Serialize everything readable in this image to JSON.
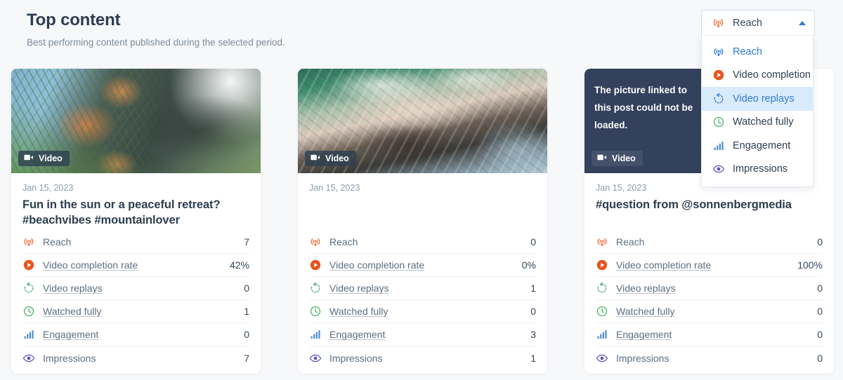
{
  "header": {
    "title": "Top content",
    "subtitle": "Best performing content published during the selected period."
  },
  "metric_selector": {
    "selected_label": "Reach",
    "selected_icon": "reach-antenna-icon",
    "chevron_icon": "chevron-up-icon",
    "options": [
      {
        "label": "Reach",
        "icon": "reach-antenna-icon",
        "state": "selected"
      },
      {
        "label": "Video completion rate",
        "icon": "play-circle-icon",
        "state": "normal"
      },
      {
        "label": "Video replays",
        "icon": "replay-arrow-icon",
        "state": "highlighted"
      },
      {
        "label": "Watched fully",
        "icon": "clock-icon",
        "state": "normal"
      },
      {
        "label": "Engagement",
        "icon": "bar-chart-icon",
        "state": "normal"
      },
      {
        "label": "Impressions",
        "icon": "eye-icon",
        "state": "normal"
      }
    ]
  },
  "colors": {
    "page_background": "#f7f8fa",
    "card_background": "#ffffff",
    "accent_blue": "#2e7cd6",
    "highlight_blue": "#d9ebfb",
    "reach_orange": "#f2703f",
    "video_orange": "#e8551f",
    "replay_green": "#4caf7d",
    "clock_green": "#3fae5a",
    "engagement_blue": "#4e8fd1",
    "impressions_purple": "#5b4bb5",
    "placeholder_navy": "#33415c",
    "title_navy": "#2d3e50"
  },
  "cards": [
    {
      "media": {
        "art": "palm-beach-photo",
        "badge_label": "Video",
        "badge_icon": "video-camera-icon",
        "placeholder_text": ""
      },
      "date": "Jan 15, 2023",
      "title": "Fun in the sun or a peaceful retreat? #beachvibes #mountainlover",
      "metrics": [
        {
          "label": "Reach",
          "icon": "reach-antenna-icon",
          "value": "7",
          "linked": false
        },
        {
          "label": "Video completion rate",
          "icon": "play-circle-icon",
          "value": "42%",
          "linked": true
        },
        {
          "label": "Video replays",
          "icon": "replay-arrow-icon",
          "value": "0",
          "linked": true
        },
        {
          "label": "Watched fully",
          "icon": "clock-icon",
          "value": "1",
          "linked": true
        },
        {
          "label": "Engagement",
          "icon": "bar-chart-icon",
          "value": "0",
          "linked": true
        },
        {
          "label": "Impressions",
          "icon": "eye-icon",
          "value": "7",
          "linked": false
        }
      ]
    },
    {
      "media": {
        "art": "ocean-aerial-photo",
        "badge_label": "Video",
        "badge_icon": "video-camera-icon",
        "placeholder_text": ""
      },
      "date": "Jan 15, 2023",
      "title": "",
      "metrics": [
        {
          "label": "Reach",
          "icon": "reach-antenna-icon",
          "value": "0",
          "linked": false
        },
        {
          "label": "Video completion rate",
          "icon": "play-circle-icon",
          "value": "0%",
          "linked": true
        },
        {
          "label": "Video replays",
          "icon": "replay-arrow-icon",
          "value": "1",
          "linked": true
        },
        {
          "label": "Watched fully",
          "icon": "clock-icon",
          "value": "0",
          "linked": true
        },
        {
          "label": "Engagement",
          "icon": "bar-chart-icon",
          "value": "3",
          "linked": true
        },
        {
          "label": "Impressions",
          "icon": "eye-icon",
          "value": "1",
          "linked": false
        }
      ]
    },
    {
      "media": {
        "art": "broken-image-placeholder",
        "badge_label": "Video",
        "badge_icon": "video-camera-icon",
        "placeholder_text": "The picture linked to this post could not be loaded."
      },
      "date": "Jan 15, 2023",
      "title": "#question from @sonnenbergmedia",
      "metrics": [
        {
          "label": "Reach",
          "icon": "reach-antenna-icon",
          "value": "0",
          "linked": false
        },
        {
          "label": "Video completion rate",
          "icon": "play-circle-icon",
          "value": "100%",
          "linked": true
        },
        {
          "label": "Video replays",
          "icon": "replay-arrow-icon",
          "value": "0",
          "linked": true
        },
        {
          "label": "Watched fully",
          "icon": "clock-icon",
          "value": "0",
          "linked": true
        },
        {
          "label": "Engagement",
          "icon": "bar-chart-icon",
          "value": "0",
          "linked": true
        },
        {
          "label": "Impressions",
          "icon": "eye-icon",
          "value": "0",
          "linked": false
        }
      ]
    }
  ]
}
